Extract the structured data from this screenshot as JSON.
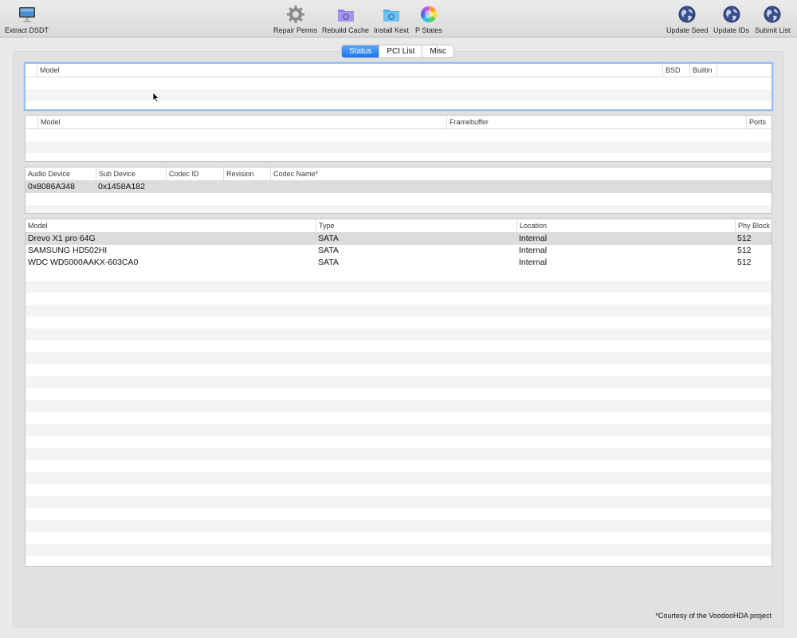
{
  "toolbar": {
    "left": [
      {
        "label": "Extract DSDT",
        "icon": "imac-icon"
      }
    ],
    "center": [
      {
        "label": "Repair Perms",
        "icon": "gear-icon"
      },
      {
        "label": "Rebuild Cache",
        "icon": "cache-folder-icon"
      },
      {
        "label": "Install Kext",
        "icon": "kext-folder-icon"
      },
      {
        "label": "P States",
        "icon": "color-wheel-icon"
      }
    ],
    "right": [
      {
        "label": "Update Seed",
        "icon": "globe-icon"
      },
      {
        "label": "Update IDs",
        "icon": "globe-icon"
      },
      {
        "label": "Submit List",
        "icon": "globe-icon"
      }
    ]
  },
  "tabs": {
    "items": [
      "Status",
      "PCI List",
      "Misc"
    ],
    "active": "Status"
  },
  "network_table": {
    "columns": [
      "Model",
      "BSD",
      "Builtin"
    ],
    "rows": []
  },
  "graphics_table": {
    "columns": [
      "Model",
      "Framebuffer",
      "Ports"
    ],
    "rows": []
  },
  "audio_table": {
    "columns": [
      "Audio Device",
      "Sub Device",
      "Codec ID",
      "Revision",
      "Codec Name*"
    ],
    "rows": [
      [
        "0x8086A348",
        "0x1458A182",
        "",
        "",
        ""
      ]
    ]
  },
  "storage_table": {
    "columns": [
      "Model",
      "Type",
      "Location",
      "Phy Block"
    ],
    "rows": [
      [
        "Drevo X1 pro 64G",
        "SATA",
        "Internal",
        "512"
      ],
      [
        "SAMSUNG HD502HI",
        "SATA",
        "Internal",
        "512"
      ],
      [
        "WDC WD5000AAKX-603CA0",
        "SATA",
        "Internal",
        "512"
      ]
    ]
  },
  "footnote": "*Courtesy of the VoodooHDA project",
  "colors": {
    "accent": "#1c75f0",
    "focus_ring": "#95bff0",
    "row_alt": "#f4f4f4",
    "row_selected": "#dcdcdc"
  }
}
